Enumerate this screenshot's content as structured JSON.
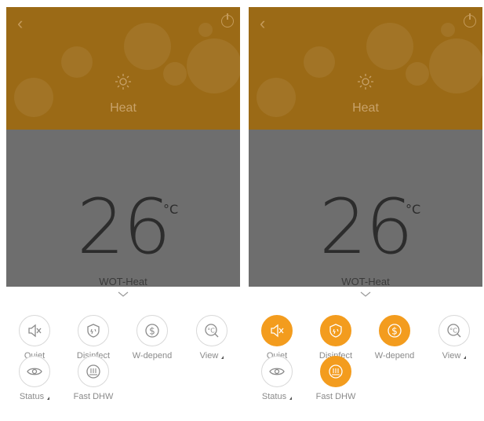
{
  "screens": [
    {
      "mode": "Heat",
      "temperature": "26",
      "unit": "°C",
      "submode": "WOT-Heat",
      "buttons": [
        {
          "label": "Quiet",
          "active": false
        },
        {
          "label": "Disinfect",
          "active": false
        },
        {
          "label": "W-depend",
          "active": false
        },
        {
          "label": "View",
          "active": false
        },
        {
          "label": "Status",
          "active": false
        },
        {
          "label": "Fast DHW",
          "active": false
        }
      ]
    },
    {
      "mode": "Heat",
      "temperature": "26",
      "unit": "°C",
      "submode": "WOT-Heat",
      "buttons": [
        {
          "label": "Quiet",
          "active": true
        },
        {
          "label": "Disinfect",
          "active": true
        },
        {
          "label": "W-depend",
          "active": true
        },
        {
          "label": "View",
          "active": false
        },
        {
          "label": "Status",
          "active": false
        },
        {
          "label": "Fast DHW",
          "active": true
        }
      ]
    }
  ],
  "colors": {
    "hero": "#9b6a16",
    "overlay": "#6e6e6e",
    "accent": "#f39c1e",
    "icon": "#8a8a8a"
  },
  "icons": [
    "back-icon",
    "power-icon",
    "sun-icon",
    "chevron-down-icon",
    "mute-icon",
    "shield-icon",
    "dollar-icon",
    "thermometer-view-icon",
    "eye-icon",
    "fast-dhw-icon"
  ]
}
